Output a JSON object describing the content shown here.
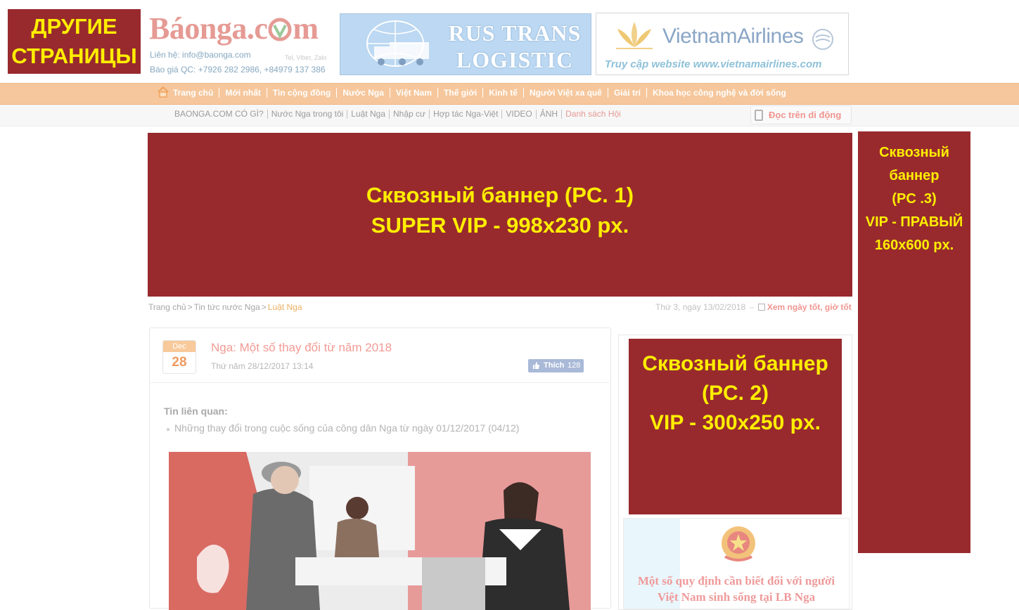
{
  "header": {
    "other_pages": [
      "ДРУГИЕ",
      "СТРАНИЦЫ"
    ],
    "logo": {
      "brand": "Báonga.c",
      "brand_tail": "m",
      "contact": "Liên hệ: info@baonga.com",
      "tel": "Tel, Viber, Zalo",
      "ad_price": "Báo giá QC: +7926 282 2986, +84979 137 386"
    },
    "rus_banner": [
      "RUS TRANS",
      "LOGISTIC"
    ],
    "vn_banner": {
      "name": "VietnamAirlines",
      "sub": "Truy cập website www.vietnamairlines.com"
    }
  },
  "main_nav": [
    "Trang chủ",
    "Mới nhất",
    "Tin cộng đồng",
    "Nước Nga",
    "Việt Nam",
    "Thế giới",
    "Kinh tế",
    "Người Việt xa quê",
    "Giải trí",
    "Khoa học công nghệ và đời sống"
  ],
  "sub_nav": [
    {
      "label": "BAONGA.COM CÓ GÌ?"
    },
    {
      "label": "Nước Nga trong tôi"
    },
    {
      "label": "Luật Nga"
    },
    {
      "label": "Nhập cư"
    },
    {
      "label": "Hợp tác Nga-Việt"
    },
    {
      "label": "VIDEO"
    },
    {
      "label": "ẢNH"
    },
    {
      "label": "Danh sách Hội"
    }
  ],
  "mobile_label": "Đọc trên di động",
  "banner1": [
    "Сквозный баннер (PC. 1)",
    "SUPER VIP - 998x230 px."
  ],
  "banner2": [
    "Сквозный баннер",
    "(PC. 2)",
    "VIP - 300x250 px."
  ],
  "banner3": [
    "Сквозный",
    "баннер",
    "(PC .3)",
    "VIP - ПРАВЫЙ",
    "160x600 px."
  ],
  "breadcrumb": [
    "Trang chủ",
    "Tin tức nước Nga",
    "Luật Nga"
  ],
  "date_line": {
    "date": "Thứ 3, ngày 13/02/2018",
    "link": "Xem ngày tốt, giờ tốt"
  },
  "article": {
    "month": "Dec",
    "day": "28",
    "title": "Nga: Một số thay đổi từ năm 2018",
    "time": "Thứ năm 28/12/2017 13:14",
    "like_label": "Thích",
    "like_count": "128",
    "related_heading": "Tin liên quan:",
    "related_items": [
      "Những thay đổi trong cuộc sống của công dân Nga từ ngày 01/12/2017 (04/12)"
    ]
  },
  "info_card": {
    "title_lines": [
      "Một số quy định cần biết đối với người",
      "Việt Nam sinh sống tại LB Nga"
    ]
  },
  "colors": {
    "ad_red": "#982a2e",
    "ad_text": "#ffee00",
    "nav_orange": "#f6c79c",
    "accent_pink": "#f29b94"
  }
}
